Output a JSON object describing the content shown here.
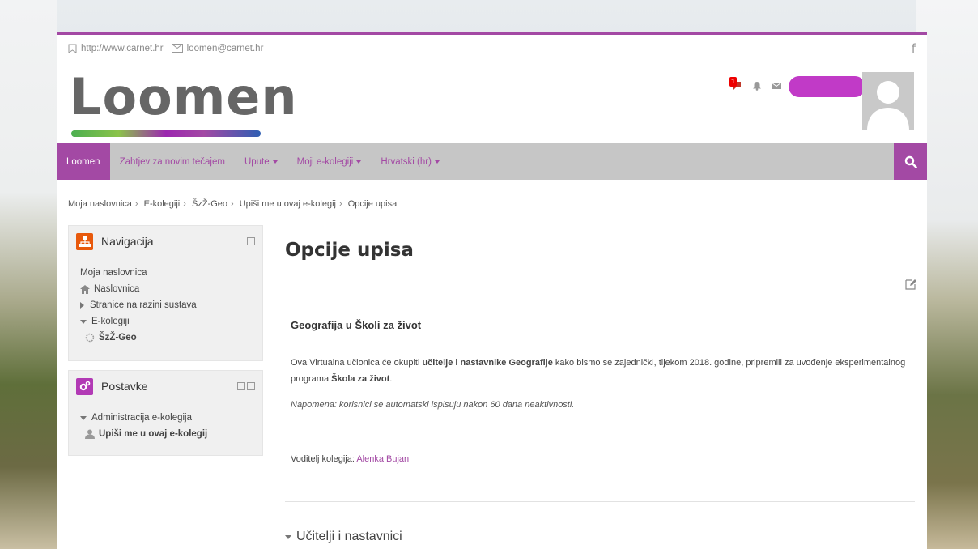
{
  "topbar": {
    "url": "http://www.carnet.hr",
    "email": "loomen@carnet.hr"
  },
  "header": {
    "logo": "Loomen",
    "notification_count": "1"
  },
  "nav": {
    "items": [
      {
        "label": "Loomen",
        "active": true,
        "dropdown": false
      },
      {
        "label": "Zahtjev za novim tečajem",
        "active": false,
        "dropdown": false
      },
      {
        "label": "Upute",
        "active": false,
        "dropdown": true
      },
      {
        "label": "Moji e-kolegiji",
        "active": false,
        "dropdown": true
      },
      {
        "label": "Hrvatski (hr)",
        "active": false,
        "dropdown": true
      }
    ]
  },
  "breadcrumb": [
    "Moja naslovnica",
    "E-kolegiji",
    "ŠzŽ-Geo",
    "Upiši me u ovaj e-kolegij",
    "Opcije upisa"
  ],
  "navigation_block": {
    "title": "Navigacija",
    "items": {
      "home": "Moja naslovnica",
      "site_home": "Naslovnica",
      "site_pages": "Stranice na razini sustava",
      "courses": "E-kolegiji",
      "course": "ŠzŽ-Geo"
    }
  },
  "settings_block": {
    "title": "Postavke",
    "admin": "Administracija e-kolegija",
    "enrol": "Upiši me u ovaj e-kolegij"
  },
  "main": {
    "title": "Opcije upisa",
    "course_name": "Geografija u Školi za život",
    "summary_1": "Ova Virtualna učionica će okupiti ",
    "summary_bold_1": "učitelje i nastavnike Geografije",
    "summary_2": " kako bismo se zajednički, tijekom 2018. godine, pripremili za uvođenje eksperimentalnog programa ",
    "summary_bold_2": "Škola za život",
    "summary_3": ".",
    "note": "Napomena: korisnici se automatski ispisuju nakon 60  dana neaktivnosti.",
    "teacher_label": "Voditelj kolegija: ",
    "teacher_name": "Alenka Bujan",
    "section": "Učitelji i nastavnici"
  },
  "colors": {
    "accent": "#a349a4",
    "navbar": "#c6c6c6",
    "nav_icon_orange": "#e8590c",
    "settings_icon": "#b23ab5"
  }
}
